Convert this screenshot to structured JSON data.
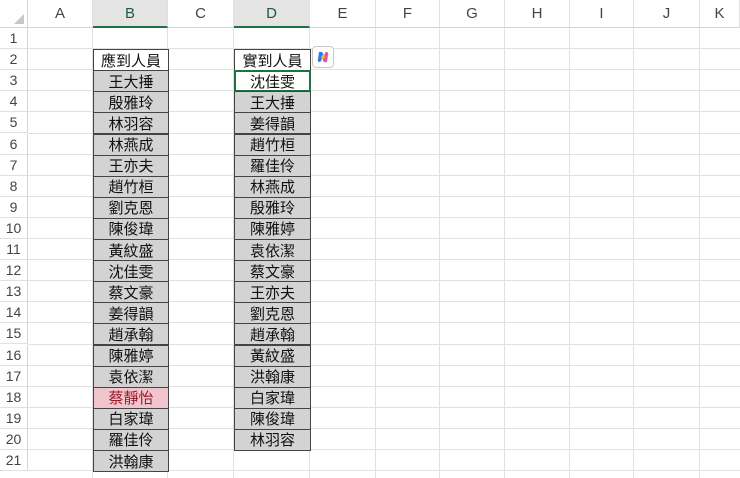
{
  "columns": [
    "A",
    "B",
    "C",
    "D",
    "E",
    "F",
    "G",
    "H",
    "I",
    "J",
    "K"
  ],
  "selected_columns": [
    "B",
    "D"
  ],
  "rows": [
    "1",
    "2",
    "3",
    "4",
    "5",
    "6",
    "7",
    "8",
    "9",
    "10",
    "11",
    "12",
    "13",
    "14",
    "15",
    "16",
    "17",
    "18",
    "19",
    "20",
    "21"
  ],
  "colB": {
    "header": "應到人員",
    "names": [
      "王大捶",
      "殷雅玲",
      "林羽容",
      "林燕成",
      "王亦夫",
      "趙竹桓",
      "劉克恩",
      "陳俊瑋",
      "黃紋盛",
      "沈佳雯",
      "蔡文豪",
      "姜得韻",
      "趙承翰",
      "陳雅婷",
      "袁依潔",
      "蔡靜怡",
      "白家瑋",
      "羅佳伶",
      "洪翰康"
    ],
    "highlighted_name": "蔡靜怡"
  },
  "colD": {
    "header": "實到人員",
    "names": [
      "沈佳雯",
      "王大捶",
      "姜得韻",
      "趙竹桓",
      "羅佳伶",
      "林燕成",
      "殷雅玲",
      "陳雅婷",
      "袁依潔",
      "蔡文豪",
      "王亦夫",
      "劉克恩",
      "趙承翰",
      "黃紋盛",
      "洪翰康",
      "白家瑋",
      "陳俊瑋",
      "林羽容"
    ],
    "active_name": "沈佳雯"
  },
  "copilot_icon": "copilot-icon",
  "colors": {
    "selected_header_accent": "#1e7145",
    "cell_fill": "#d3d3d3",
    "highlight_fill": "#f1c5cd",
    "highlight_text": "#9c1c2e"
  }
}
